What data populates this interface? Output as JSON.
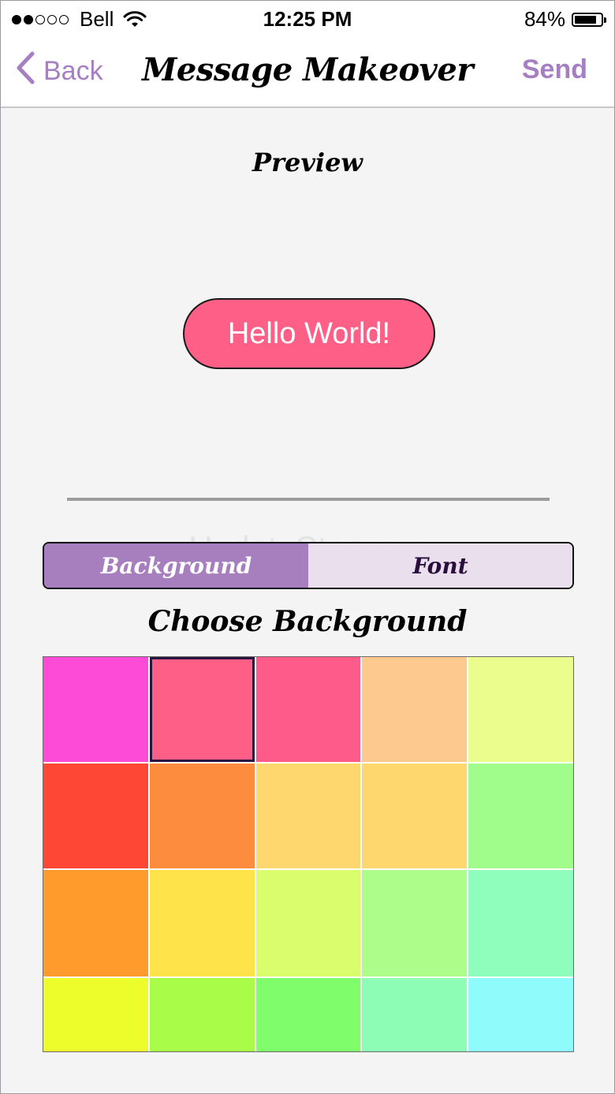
{
  "status": {
    "carrier": "Bell",
    "time": "12:25 PM",
    "battery_text": "84%",
    "battery_level": 0.84
  },
  "nav": {
    "back_label": "Back",
    "title": "Message Makeover",
    "send_label": "Send"
  },
  "preview": {
    "label": "Preview",
    "message": "Hello World!",
    "bubble_color": "#fd5f86"
  },
  "tabs": [
    {
      "label": "Background",
      "active": true
    },
    {
      "label": "Font",
      "active": false
    }
  ],
  "watermark": "UpdateStar.com",
  "choose": {
    "label": "Choose Background"
  },
  "colors": {
    "accent": "#a67fc2"
  },
  "swatches": [
    "#fd4bd8",
    "#fd5f86",
    "#fe5b8a",
    "#fec98e",
    "#ebfd8d",
    "#fe4734",
    "#fe8c3f",
    "#fed76f",
    "#fed86e",
    "#a1fd8b",
    "#fe9b2c",
    "#fee44a",
    "#dafd6e",
    "#acfd89",
    "#8ffdbc",
    "#edfd2c",
    "#a9fd48",
    "#80fd6b",
    "#8dfdb5",
    "#8ffcfb"
  ],
  "selected_swatch": 1
}
